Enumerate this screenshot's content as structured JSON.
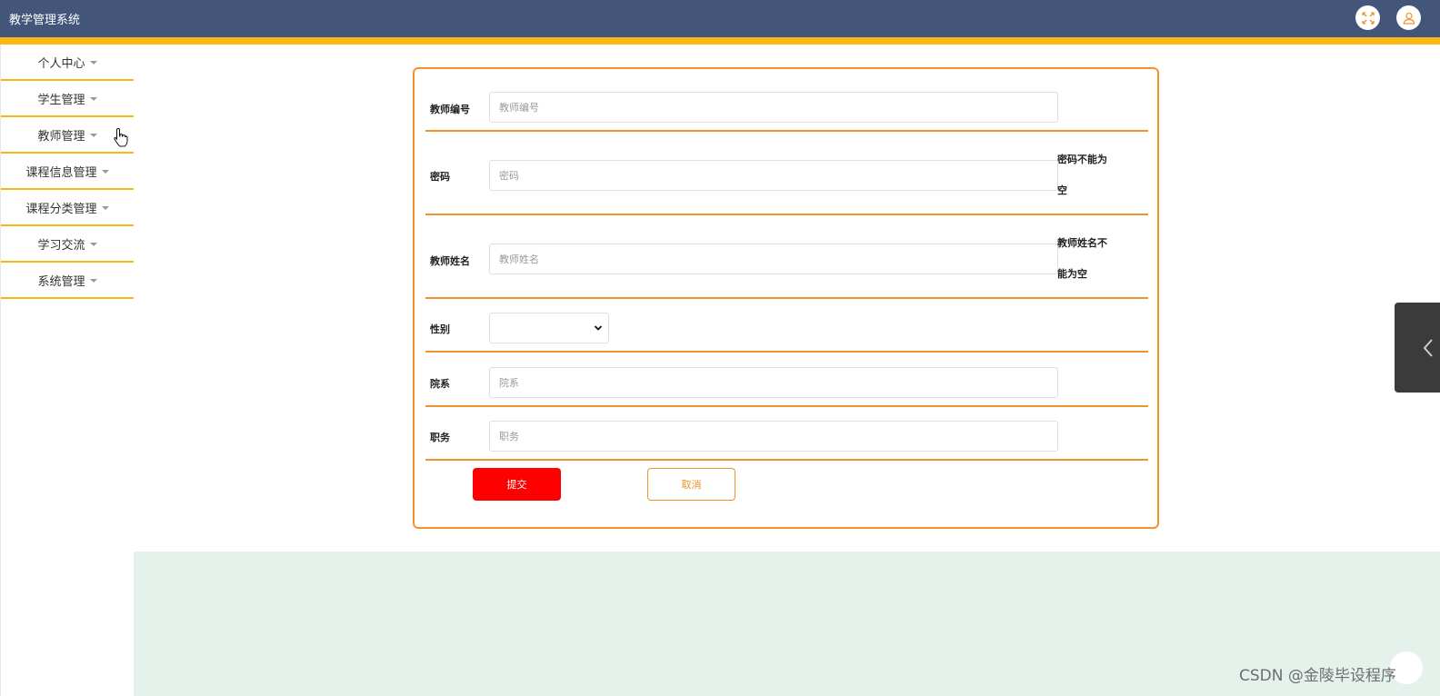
{
  "app": {
    "title": "教学管理系统"
  },
  "header": {
    "fullscreen_icon": "expand-icon",
    "user_icon": "user-icon"
  },
  "sidebar": {
    "items": [
      {
        "label": "个人中心"
      },
      {
        "label": "学生管理"
      },
      {
        "label": "教师管理"
      },
      {
        "label": "课程信息管理"
      },
      {
        "label": "课程分类管理"
      },
      {
        "label": "学习交流"
      },
      {
        "label": "系统管理"
      }
    ]
  },
  "form": {
    "teacher_id": {
      "label": "教师编号",
      "placeholder": "教师编号",
      "value": ""
    },
    "password": {
      "label": "密码",
      "placeholder": "密码",
      "value": "",
      "error_line1": "密码不能为",
      "error_line2": "空"
    },
    "teacher_name": {
      "label": "教师姓名",
      "placeholder": "教师姓名",
      "value": "",
      "error_line1": "教师姓名不",
      "error_line2": "能为空"
    },
    "gender": {
      "label": "性别",
      "selected": ""
    },
    "department": {
      "label": "院系",
      "placeholder": "院系",
      "value": ""
    },
    "position": {
      "label": "职务",
      "placeholder": "职务",
      "value": ""
    },
    "submit_label": "提交",
    "cancel_label": "取消"
  },
  "watermark": "CSDN @金陵毕设程序",
  "colors": {
    "header_bg": "#43567a",
    "accent_yellow": "#f9b715",
    "form_border": "#f0932b",
    "submit_bg": "#ff0000",
    "footer_bg": "#e5f1eb"
  }
}
